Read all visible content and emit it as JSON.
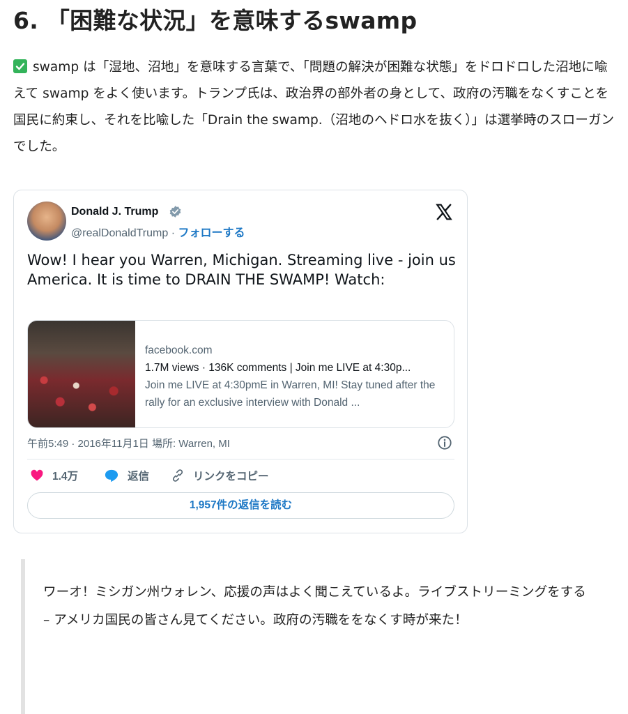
{
  "article": {
    "heading": "6. 「困難な状況」を意味するswamp",
    "paragraph": "swamp は「湿地、沼地」を意味する言葉で、「問題の解決が困難な状態」をドロドロした沼地に喩えて swamp をよく使います。トランプ氏は、政治界の部外者の身として、政府の汚職をなくすことを国民に約束し、それを比喩した「Drain the swamp.（沼地のヘドロ水を抜く）」は選挙時のスローガンでした。"
  },
  "tweet": {
    "author_name": "Donald J. Trump",
    "handle": "@realDonaldTrump",
    "separator": " · ",
    "follow_label": "フォローする",
    "text": "Wow! I hear you Warren, Michigan. Streaming live - join us America. It is time to DRAIN THE SWAMP! Watch:",
    "link_card": {
      "domain": "facebook.com",
      "title": "1.7M views · 136K comments | Join me LIVE at 4:30p...",
      "description": "Join me LIVE at 4:30pmE in Warren, MI! Stay tuned after the rally for an exclusive interview with Donald ..."
    },
    "meta": "午前5:49 · 2016年11月1日 場所: Warren, MI",
    "likes": "1.4万",
    "reply_label": "返信",
    "copy_link_label": "リンクをコピー",
    "read_replies_label": "1,957件の返信を読む"
  },
  "translation": "ワーオ！ミシガン州ウォレン、応援の声はよく聞こえているよ。ライブストリーミングをする – アメリカ国民の皆さん見てください。政府の汚職ををなくす時が来た！",
  "colors": {
    "check": "#33b35a",
    "link_blue": "#1d78c5",
    "like_pink": "#f91880",
    "reply_blue": "#1d9bf0",
    "verified": "#829aab"
  },
  "icons": {
    "check": "check-icon",
    "verified": "verified-badge-icon",
    "x_logo": "x-logo-icon",
    "info": "info-icon",
    "heart": "heart-icon",
    "reply": "reply-bubble-icon",
    "link": "link-icon"
  }
}
